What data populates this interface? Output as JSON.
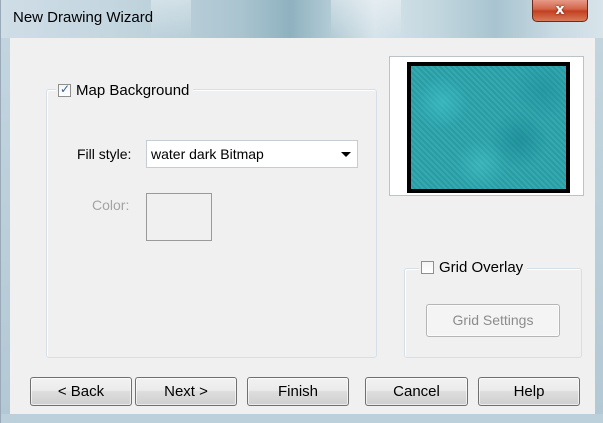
{
  "window": {
    "title": "New Drawing Wizard",
    "close_glyph": "x"
  },
  "map_background": {
    "label": "Map Background",
    "checked": true,
    "check_glyph": "✓",
    "fill_style_label": "Fill style:",
    "fill_style_value": "water dark Bitmap",
    "color_label": "Color:"
  },
  "preview": {
    "description_color": "#2aa3ac"
  },
  "grid_overlay": {
    "label": "Grid Overlay",
    "checked": false,
    "settings_button": "Grid Settings"
  },
  "buttons": {
    "back": "< Back",
    "next": "Next >",
    "finish": "Finish",
    "cancel": "Cancel",
    "help": "Help"
  },
  "colors": {
    "dialog_background": "#f0f0f0",
    "disabled_text": "#a3a3a3",
    "preview_water": "#2aa3ac",
    "close_button": "#c2401f"
  }
}
